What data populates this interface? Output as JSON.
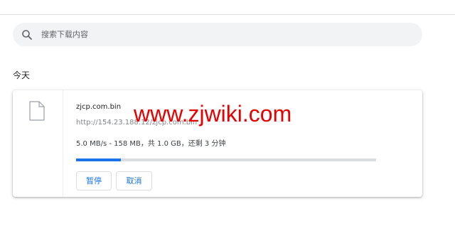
{
  "search": {
    "placeholder": "搜索下载内容",
    "icon": "search-icon"
  },
  "section": {
    "title": "今天"
  },
  "download": {
    "file_icon": "file-icon",
    "filename": "zjcp.com.bin",
    "url": "http://154.23.188.12/zjcp.com.bin",
    "status": "5.0 MB/s - 158 MB，共 1.0 GB，还剩 3 分钟",
    "progress_fraction": 0.15,
    "pause_label": "暂停",
    "cancel_label": "取消"
  },
  "watermark": {
    "text": "www.zjwiki.com"
  },
  "colors": {
    "accent": "#1a73e8",
    "watermark": "#e60000"
  }
}
